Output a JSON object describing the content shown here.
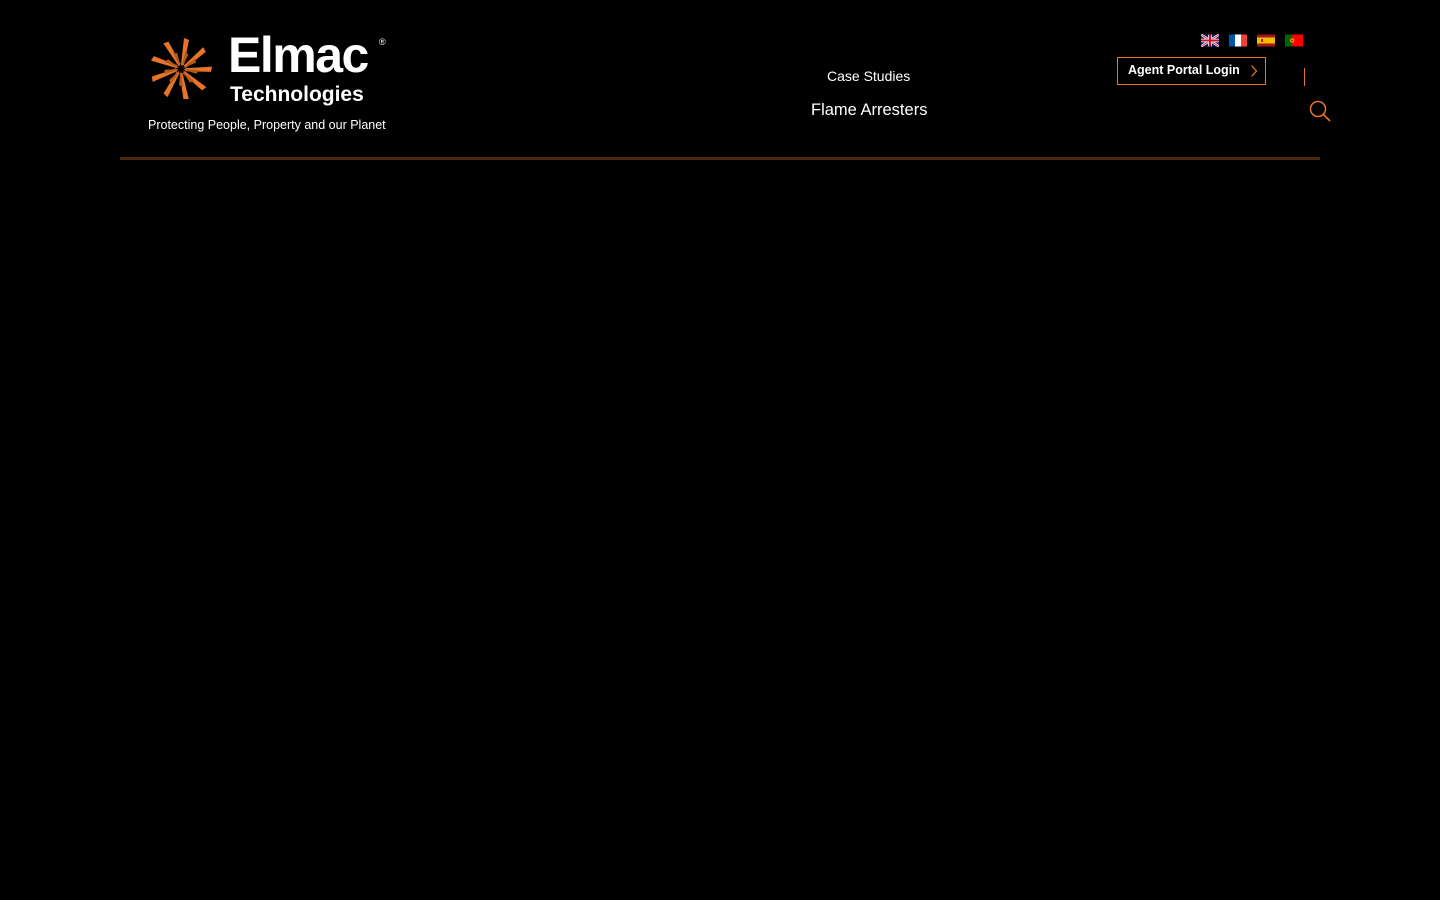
{
  "brand": {
    "name": "Elmac",
    "registered_mark": "®",
    "subname": "Technologies",
    "tagline": "Protecting People, Property and our Planet",
    "logo_icon": "starburst-logo-icon",
    "logo_color": "#e8742a"
  },
  "nav": {
    "items": [
      {
        "label": "Case Studies"
      },
      {
        "label": "Flame Arresters"
      }
    ]
  },
  "languages": [
    {
      "icon": "uk-flag-icon"
    },
    {
      "icon": "france-flag-icon"
    },
    {
      "icon": "spain-flag-icon"
    },
    {
      "icon": "portugal-flag-icon"
    }
  ],
  "agent_portal": {
    "label": "Agent Portal Login",
    "icon": "chevron-right-icon"
  },
  "search": {
    "icon": "search-icon"
  },
  "colors": {
    "background": "#000000",
    "accent": "#e8742a",
    "rule": "#4a2812",
    "text": "#ffffff"
  }
}
